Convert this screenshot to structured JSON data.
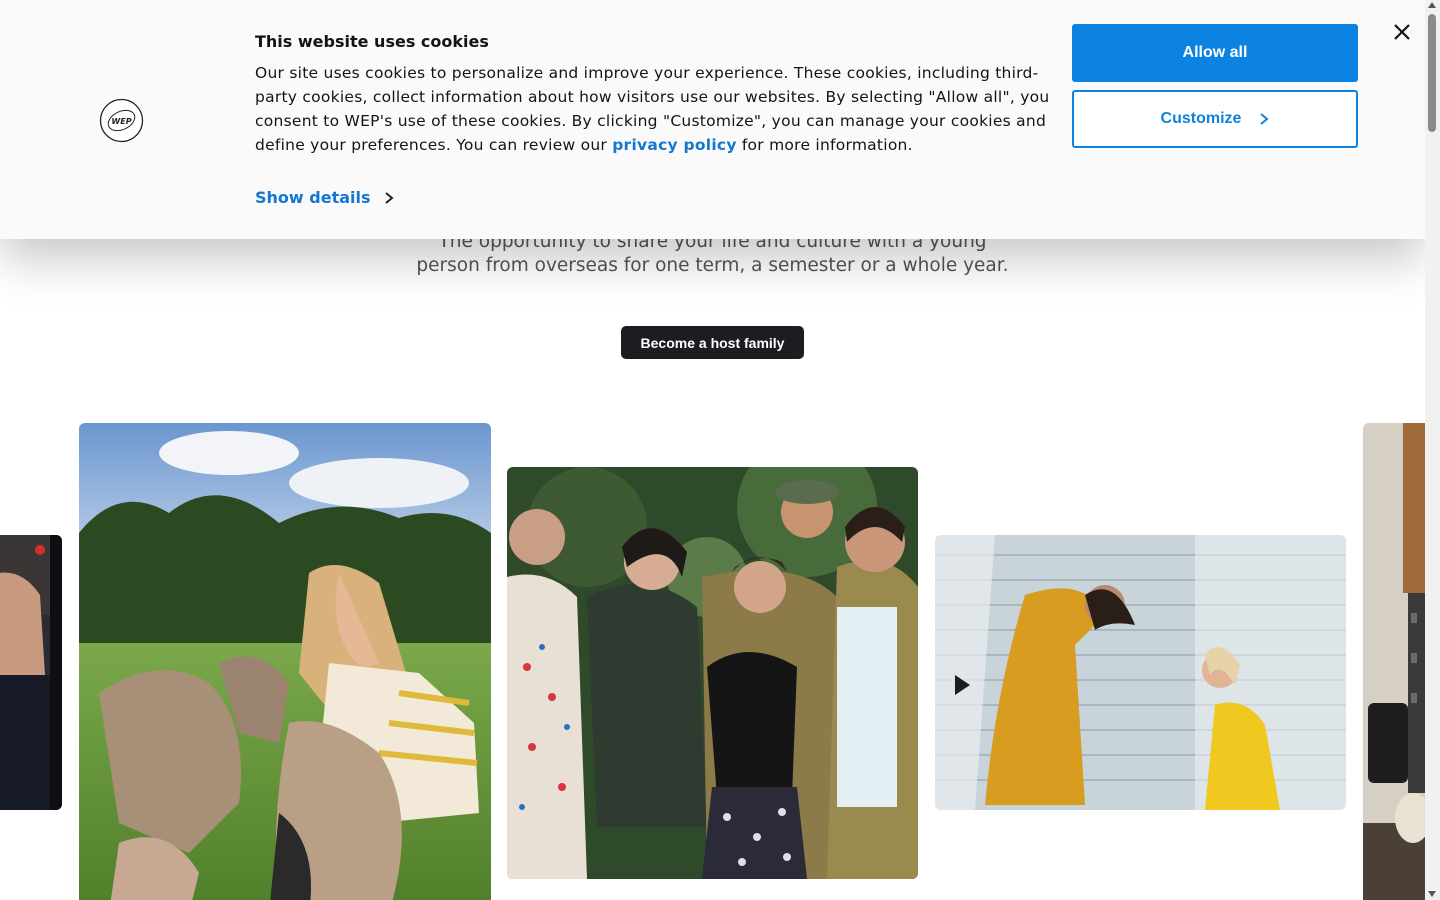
{
  "cookie_banner": {
    "title": "This website uses cookies",
    "body_before_link": "Our site uses cookies to personalize and improve your experience. These cookies, including third-party cookies, collect information about how visitors use our websites. By selecting \"Allow all\", you consent to WEP's use of these cookies. By clicking \"Customize\", you can manage your cookies and define your preferences. You can review our ",
    "link_text": "privacy policy",
    "body_after_link": " for more information.",
    "show_details": "Show details",
    "allow_all": "Allow all",
    "customize": "Customize",
    "logo_text": "WEP"
  },
  "hero": {
    "subtitle_line1": "The opportunity to share your life and culture with a young",
    "subtitle_line2": "person from overseas for one term, a semester or a whole year.",
    "cta": "Become a host family"
  },
  "colors": {
    "accent": "#0c83e0",
    "link": "#1577d0",
    "cta_bg": "#1c1d20",
    "banner_bg": "#fafafa"
  },
  "gallery": [
    {
      "subject": "person in dark clothing (cropped)"
    },
    {
      "subject": "girl feeding kangaroos on grass"
    },
    {
      "subject": "family group portrait outdoors"
    },
    {
      "subject": "woman and child in yellow dresses facing each other"
    },
    {
      "subject": "kitchen interior (cropped)"
    }
  ]
}
